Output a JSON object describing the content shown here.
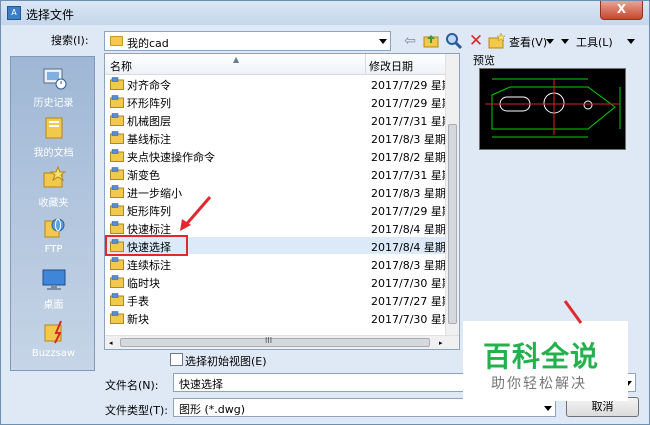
{
  "title": "选择文件",
  "close_label": "X",
  "search": {
    "label": "搜索(I):",
    "value": "我的cad"
  },
  "toolbar": {
    "view_label": "查看(V)",
    "tools_label": "工具(L)"
  },
  "places": [
    {
      "label": "历史记录"
    },
    {
      "label": "我的文档"
    },
    {
      "label": "收藏夹"
    },
    {
      "label": "FTP"
    },
    {
      "label": "桌面"
    },
    {
      "label": "Buzzsaw"
    }
  ],
  "columns": {
    "name": "名称",
    "date": "修改日期"
  },
  "files": [
    {
      "name": "对齐命令",
      "date": "2017/7/29 星期"
    },
    {
      "name": "环形阵列",
      "date": "2017/7/29 星期"
    },
    {
      "name": "机械图层",
      "date": "2017/7/31 星期"
    },
    {
      "name": "基线标注",
      "date": "2017/8/3 星期"
    },
    {
      "name": "夹点快速操作命令",
      "date": "2017/8/2 星期"
    },
    {
      "name": "渐变色",
      "date": "2017/7/31 星期"
    },
    {
      "name": "进一步缩小",
      "date": "2017/8/3 星期"
    },
    {
      "name": "矩形阵列",
      "date": "2017/7/29 星期"
    },
    {
      "name": "快速标注",
      "date": "2017/8/4 星期"
    },
    {
      "name": "快速选择",
      "date": "2017/8/4 星期"
    },
    {
      "name": "连续标注",
      "date": "2017/8/3 星期"
    },
    {
      "name": "临时块",
      "date": "2017/7/30 星期"
    },
    {
      "name": "手表",
      "date": "2017/7/27 星期"
    },
    {
      "name": "新块",
      "date": "2017/7/30 星期"
    }
  ],
  "preview_label": "预览",
  "initial_view_label": "选择初始视图(E)",
  "filename": {
    "label": "文件名(N):",
    "value": "快速选择"
  },
  "filetype": {
    "label": "文件类型(T):",
    "value": "图形 (*.dwg)"
  },
  "cancel_label": "取消",
  "hscroll_label": "III",
  "watermark": {
    "title": "百科全说",
    "subtitle": "助你轻松解决"
  }
}
